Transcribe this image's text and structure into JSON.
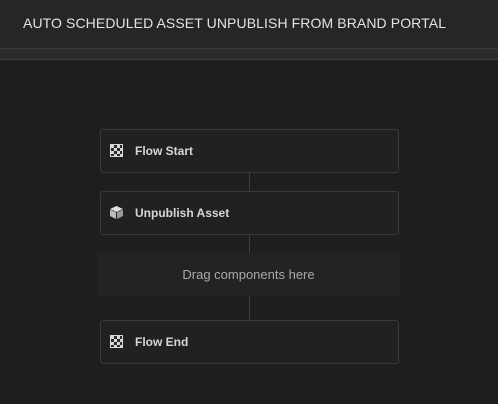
{
  "header": {
    "title": "AUTO SCHEDULED ASSET UNPUBLISH FROM BRAND PORTAL"
  },
  "workflow": {
    "steps": [
      {
        "label": "Flow Start",
        "icon": "checkered-flag-icon"
      },
      {
        "label": "Unpublish Asset",
        "icon": "box-icon"
      },
      {
        "label": "Flow End",
        "icon": "checkered-flag-icon"
      }
    ],
    "dropzone_hint": "Drag components here"
  }
}
